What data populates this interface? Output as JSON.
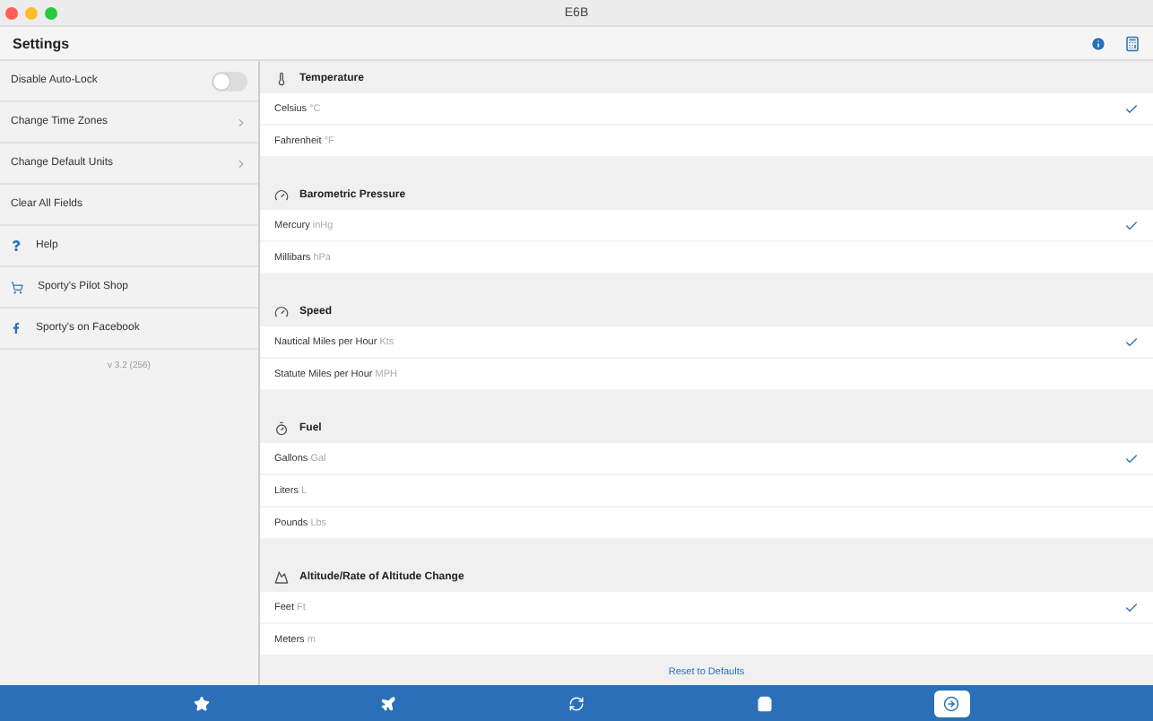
{
  "window": {
    "title": "E6B"
  },
  "header": {
    "title": "Settings"
  },
  "sidebar": {
    "items": [
      {
        "kind": "toggle",
        "label": "Disable Auto-Lock",
        "on": false
      },
      {
        "kind": "link",
        "label": "Change Time Zones"
      },
      {
        "kind": "link",
        "label": "Change Default Units"
      },
      {
        "kind": "plain",
        "label": "Clear All Fields"
      },
      {
        "kind": "help",
        "label": "Help"
      },
      {
        "kind": "cart",
        "label": "Sporty's Pilot Shop"
      },
      {
        "kind": "facebook",
        "label": "Sporty's on Facebook"
      }
    ],
    "version": "v 3.2 (256)"
  },
  "sections": [
    {
      "kind": "thermometer",
      "title": "Temperature",
      "options": [
        {
          "label": "Celsius",
          "unit": "°C",
          "selected": true
        },
        {
          "label": "Fahrenheit",
          "unit": "°F",
          "selected": false
        }
      ]
    },
    {
      "kind": "gauge",
      "title": "Barometric Pressure",
      "options": [
        {
          "label": "Mercury",
          "unit": "inHg",
          "selected": true
        },
        {
          "label": "Millibars",
          "unit": "hPa",
          "selected": false
        }
      ]
    },
    {
      "kind": "speedometer",
      "title": "Speed",
      "options": [
        {
          "label": "Nautical Miles per Hour",
          "unit": "Kts",
          "selected": true
        },
        {
          "label": "Statute Miles per Hour",
          "unit": "MPH",
          "selected": false
        }
      ]
    },
    {
      "kind": "fuel",
      "title": "Fuel",
      "options": [
        {
          "label": "Gallons",
          "unit": "Gal",
          "selected": true
        },
        {
          "label": "Liters",
          "unit": "L",
          "selected": false
        },
        {
          "label": "Pounds",
          "unit": "Lbs",
          "selected": false
        }
      ]
    },
    {
      "kind": "altitude",
      "title": "Altitude/Rate of Altitude Change",
      "options": [
        {
          "label": "Feet",
          "unit": "Ft",
          "selected": true
        },
        {
          "label": "Meters",
          "unit": "m",
          "selected": false
        }
      ]
    }
  ],
  "reset": "Reset to Defaults",
  "tabs": [
    {
      "kind": "star",
      "selected": false
    },
    {
      "kind": "plane",
      "selected": false
    },
    {
      "kind": "sync",
      "selected": false
    },
    {
      "kind": "bag",
      "selected": false
    },
    {
      "kind": "settings",
      "selected": true
    }
  ]
}
